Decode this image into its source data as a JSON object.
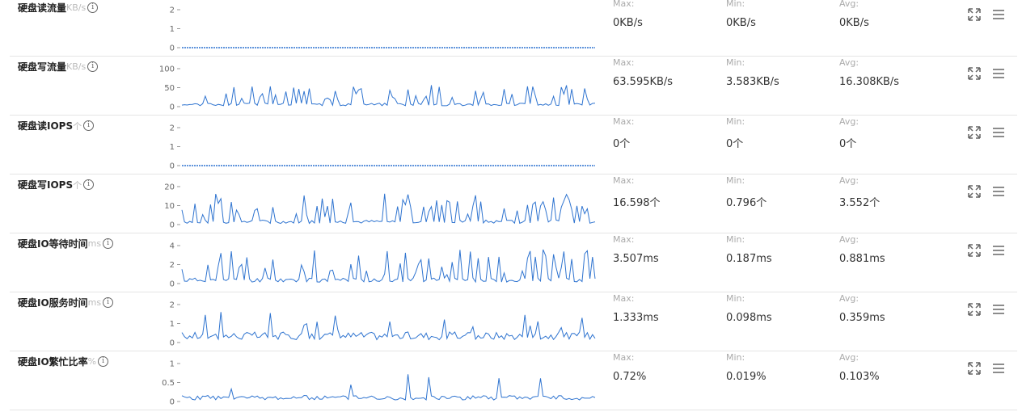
{
  "metrics": [
    {
      "title": "硬盘读流量",
      "unit": "KB/s",
      "yticks": [
        "2",
        "1",
        "0"
      ],
      "ymax": 2,
      "kind": "flat",
      "max_label": "Max:",
      "max": "0KB/s",
      "min_label": "Min:",
      "min": "0KB/s",
      "avg_label": "Avg:",
      "avg": "0KB/s"
    },
    {
      "title": "硬盘写流量",
      "unit": "KB/s",
      "yticks": [
        "100",
        "50",
        "0"
      ],
      "ymax": 100,
      "kind": "spiky",
      "seed": 3,
      "base": 8,
      "amp": 55,
      "max_label": "Max:",
      "max": "63.595KB/s",
      "min_label": "Min:",
      "min": "3.583KB/s",
      "avg_label": "Avg:",
      "avg": "16.308KB/s"
    },
    {
      "title": "硬盘读IOPS",
      "unit": "个",
      "yticks": [
        "2",
        "1",
        "0"
      ],
      "ymax": 2,
      "kind": "flat",
      "max_label": "Max:",
      "max": "0个",
      "min_label": "Min:",
      "min": "0个",
      "avg_label": "Avg:",
      "avg": "0个"
    },
    {
      "title": "硬盘写IOPS",
      "unit": "个",
      "yticks": [
        "20",
        "10",
        "0"
      ],
      "ymax": 20,
      "kind": "spiky",
      "seed": 7,
      "base": 2,
      "amp": 16,
      "max_label": "Max:",
      "max": "16.598个",
      "min_label": "Min:",
      "min": "0.796个",
      "avg_label": "Avg:",
      "avg": "3.552个"
    },
    {
      "title": "硬盘IO等待时间",
      "unit": "ms",
      "yticks": [
        "4",
        "2",
        "0"
      ],
      "ymax": 4,
      "kind": "spiky",
      "seed": 11,
      "base": 0.5,
      "amp": 3.4,
      "max_label": "Max:",
      "max": "3.507ms",
      "min_label": "Min:",
      "min": "0.187ms",
      "avg_label": "Avg:",
      "avg": "0.881ms"
    },
    {
      "title": "硬盘IO服务时间",
      "unit": "ms",
      "yticks": [
        "2",
        "1",
        "0"
      ],
      "ymax": 2,
      "kind": "noisy",
      "seed": 17,
      "base": 0.35,
      "amp": 1.3,
      "max_label": "Max:",
      "max": "1.333ms",
      "min_label": "Min:",
      "min": "0.098ms",
      "avg_label": "Avg:",
      "avg": "0.359ms"
    },
    {
      "title": "硬盘IO繁忙比率",
      "unit": "%",
      "yticks": [
        "1",
        "0.5",
        "0"
      ],
      "ymax": 1,
      "kind": "noisy",
      "seed": 23,
      "base": 0.1,
      "amp": 0.72,
      "max_label": "Max:",
      "max": "0.72%",
      "min_label": "Min:",
      "min": "0.019%",
      "avg_label": "Avg:",
      "avg": "0.103%"
    }
  ],
  "icons": {
    "info": "info-icon",
    "expand": "expand-icon",
    "menu": "menu-icon"
  },
  "colors": {
    "line": "#2f74d0",
    "grid": "#e8e8e8",
    "axis_text": "#666"
  }
}
